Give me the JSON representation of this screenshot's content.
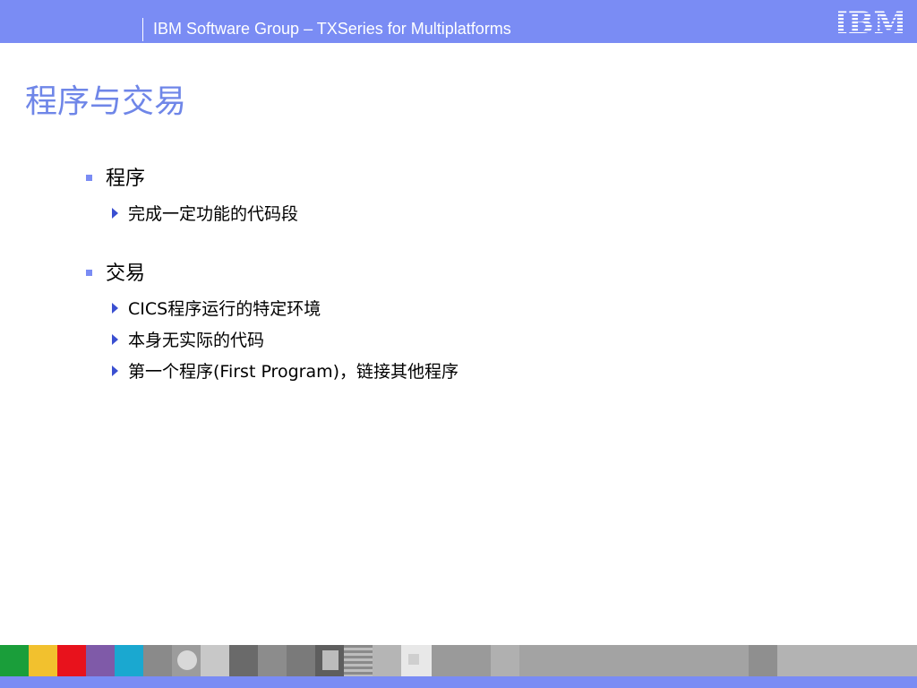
{
  "header": {
    "title": "IBM Software Group – TXSeries for Multiplatforms",
    "logo_text": "IBM"
  },
  "slide": {
    "title": "程序与交易",
    "bullets": [
      {
        "label": "程序",
        "subitems": [
          "完成一定功能的代码段"
        ]
      },
      {
        "label": "交易",
        "subitems": [
          "CICS程序运行的特定环境",
          "本身无实际的代码",
          "第一个程序(First Program)，链接其他程序"
        ]
      }
    ]
  },
  "colors": {
    "header_bg": "#7a8cf4",
    "title": "#6f86e8",
    "bullet_square": "#7a8cf4",
    "bullet_arrow": "#3a4fd1"
  },
  "footer": {
    "color_strip": [
      "#1a9e3a",
      "#f2c12e",
      "#e8121c",
      "#7f5aa8",
      "#1aa8d0"
    ]
  }
}
